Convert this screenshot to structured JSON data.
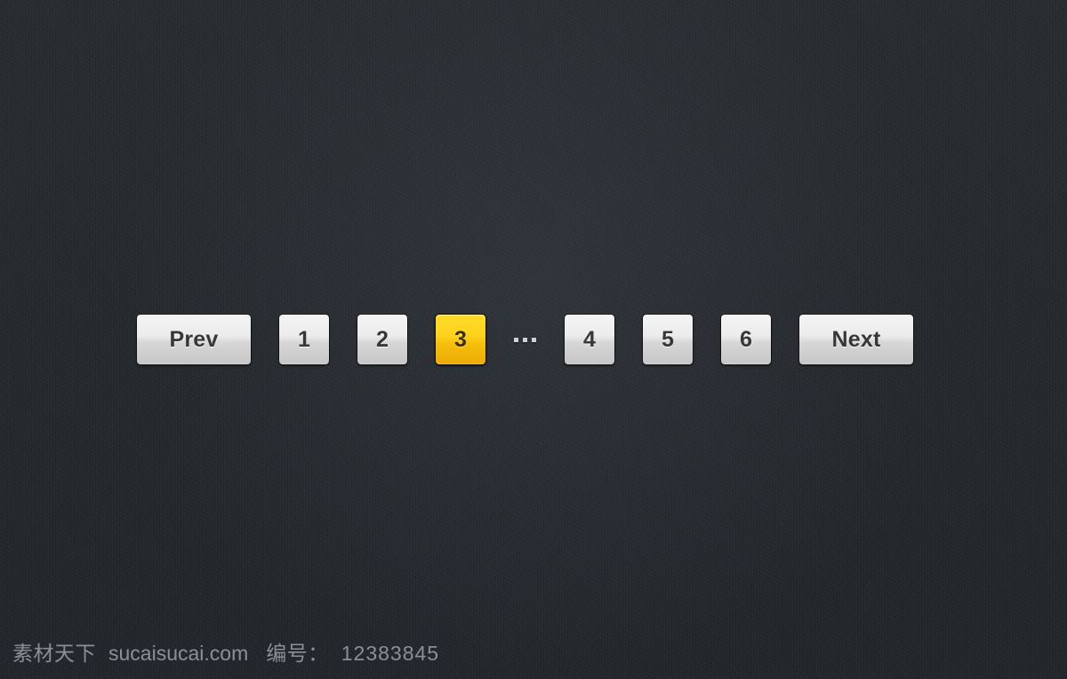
{
  "page": {
    "background_color": "#24282c",
    "texture": "dark-denim-noise"
  },
  "pagination": {
    "name": "pagination-control",
    "prev_label": "Prev",
    "next_label": "Next",
    "ellipsis": "...",
    "active_page": "3",
    "accent_color": "#fed31d",
    "button_face_color": "#ececec",
    "button_text_color": "#373737",
    "pages_left": [
      {
        "label": "1",
        "active": false
      },
      {
        "label": "2",
        "active": false
      },
      {
        "label": "3",
        "active": true
      }
    ],
    "pages_right": [
      {
        "label": "4",
        "active": false
      },
      {
        "label": "5",
        "active": false
      },
      {
        "label": "6",
        "active": false
      }
    ]
  },
  "watermark": {
    "brand": "素材天下",
    "site": "sucaisucai.com",
    "id_label": "编号：",
    "id_value": "12383845"
  }
}
